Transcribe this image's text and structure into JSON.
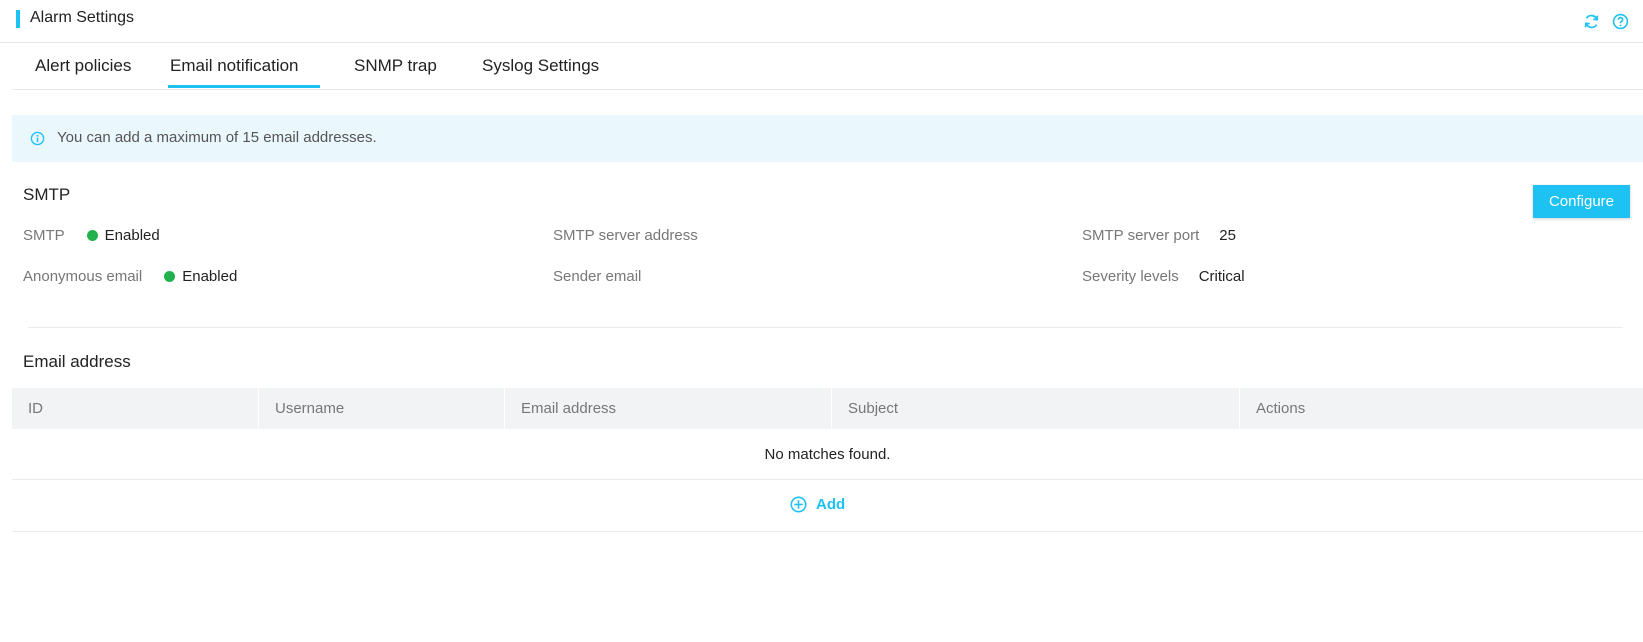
{
  "header": {
    "title": "Alarm Settings",
    "refresh_icon": "refresh-icon",
    "help_icon": "help-icon"
  },
  "tabs": [
    {
      "label": "Alert policies",
      "active": false
    },
    {
      "label": "Email notification",
      "active": true
    },
    {
      "label": "SNMP trap",
      "active": false
    },
    {
      "label": "Syslog Settings",
      "active": false
    }
  ],
  "notice": {
    "icon": "info-icon",
    "text": "You can add a maximum of 15 email addresses."
  },
  "smtp": {
    "title": "SMTP",
    "configure_label": "Configure",
    "smtp_label": "SMTP",
    "smtp_value": "Enabled",
    "anonymous_label": "Anonymous email",
    "anonymous_value": "Enabled",
    "server_address_label": "SMTP server address",
    "server_address_value": "",
    "sender_label": "Sender email",
    "sender_value": "",
    "port_label": "SMTP server port",
    "port_value": "25",
    "severity_label": "Severity levels",
    "severity_value": "Critical"
  },
  "email": {
    "title": "Email address",
    "columns": [
      "ID",
      "Username",
      "Email address",
      "Subject",
      "Actions"
    ],
    "empty_text": "No matches found.",
    "add_label": "Add"
  },
  "colors": {
    "accent": "#1ec2f2",
    "enabled": "#22b14c",
    "notice_bg": "#eaf8fd",
    "table_header_bg": "#f2f3f5"
  }
}
